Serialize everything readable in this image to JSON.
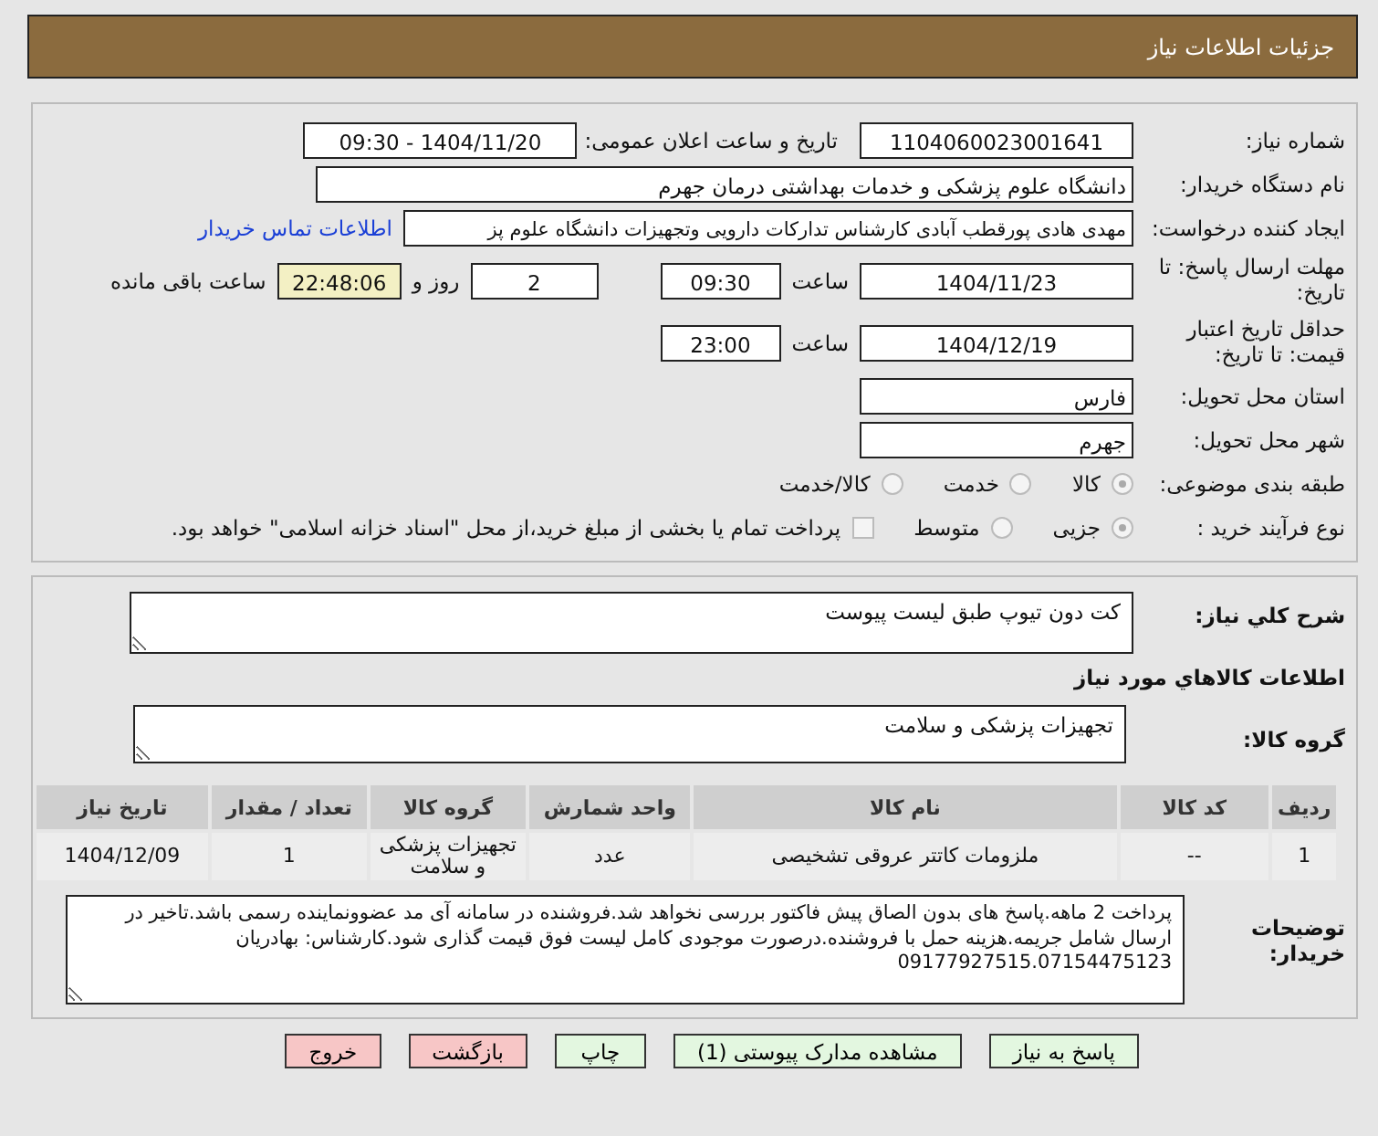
{
  "header": {
    "title": "جزئیات اطلاعات نیاز"
  },
  "details": {
    "need_number": {
      "label": "شماره نیاز:",
      "value": "1104060023001641"
    },
    "announce": {
      "label": "تاریخ و ساعت اعلان عمومی:",
      "value": "1404/11/20 - 09:30"
    },
    "buyer": {
      "label": "نام دستگاه خریدار:",
      "value": "دانشگاه علوم پزشکی و خدمات بهداشتی  درمان جهرم"
    },
    "creator": {
      "label": "ایجاد کننده درخواست:",
      "value": "مهدی هادی پورقطب آبادی کارشناس تدارکات دارویی وتجهیزات دانشگاه علوم پز",
      "link": "اطلاعات تماس خریدار"
    },
    "deadline": {
      "label": "مهلت ارسال پاسخ: تا تاریخ:",
      "date": "1404/11/23",
      "time_label": "ساعت",
      "time": "09:30",
      "days": "2",
      "days_label": "روز و",
      "remaining": "22:48:06",
      "remaining_label": "ساعت باقی مانده"
    },
    "validity": {
      "label": "حداقل تاریخ اعتبار قیمت: تا تاریخ:",
      "date": "1404/12/19",
      "time_label": "ساعت",
      "time": "23:00"
    },
    "province": {
      "label": "استان محل تحویل:",
      "value": "فارس"
    },
    "city": {
      "label": "شهر محل تحویل:",
      "value": "جهرم"
    },
    "category": {
      "label": "طبقه بندی موضوعی:",
      "options": [
        {
          "label": "کالا",
          "selected": true
        },
        {
          "label": "خدمت",
          "selected": false
        },
        {
          "label": "کالا/خدمت",
          "selected": false
        }
      ]
    },
    "process": {
      "label": "نوع فرآیند خرید :",
      "options": [
        {
          "label": "جزیی",
          "selected": true
        },
        {
          "label": "متوسط",
          "selected": false
        }
      ],
      "payment": {
        "label": "پرداخت تمام یا بخشی از مبلغ خرید،از محل \"اسناد خزانه اسلامی\" خواهد بود.",
        "checked": false
      }
    }
  },
  "goods": {
    "summary": {
      "label": "شرح کلي نياز:",
      "value": "کت دون تیوپ طبق لیست پیوست"
    },
    "section_title": "اطلاعات کالاهاي مورد نياز",
    "group": {
      "label": "گروه کالا:",
      "value": "تجهیزات پزشکی و سلامت"
    },
    "table": {
      "columns": [
        "ردیف",
        "کد کالا",
        "نام کالا",
        "واحد شمارش",
        "گروه کالا",
        "تعداد / مقدار",
        "تاریخ نیاز"
      ],
      "rows": [
        [
          "1",
          "--",
          "ملزومات کاتتر عروقی تشخیصی",
          "عدد",
          "تجهیزات پزشکی و سلامت",
          "1",
          "1404/12/09"
        ]
      ]
    },
    "notes": {
      "label": "توضیحات خریدار:",
      "value": "پرداخت 2 ماهه.پاسخ های بدون الصاق پیش فاکتور بررسی نخواهد شد.فروشنده در سامانه آی مد عضوونماینده رسمی باشد.تاخیر در ارسال شامل جریمه.هزینه حمل با فروشنده.درصورت موجودی کامل لیست فوق قیمت گذاری شود.کارشناس: بهادریان 09177927515.07154475123"
    }
  },
  "buttons": [
    {
      "label": "پاسخ به نیاز",
      "kind": "normal"
    },
    {
      "label": "مشاهده مدارک پیوستی (1)",
      "kind": "normal"
    },
    {
      "label": "چاپ",
      "kind": "normal"
    },
    {
      "label": "بازگشت",
      "kind": "danger"
    },
    {
      "label": "خروج",
      "kind": "danger"
    }
  ]
}
